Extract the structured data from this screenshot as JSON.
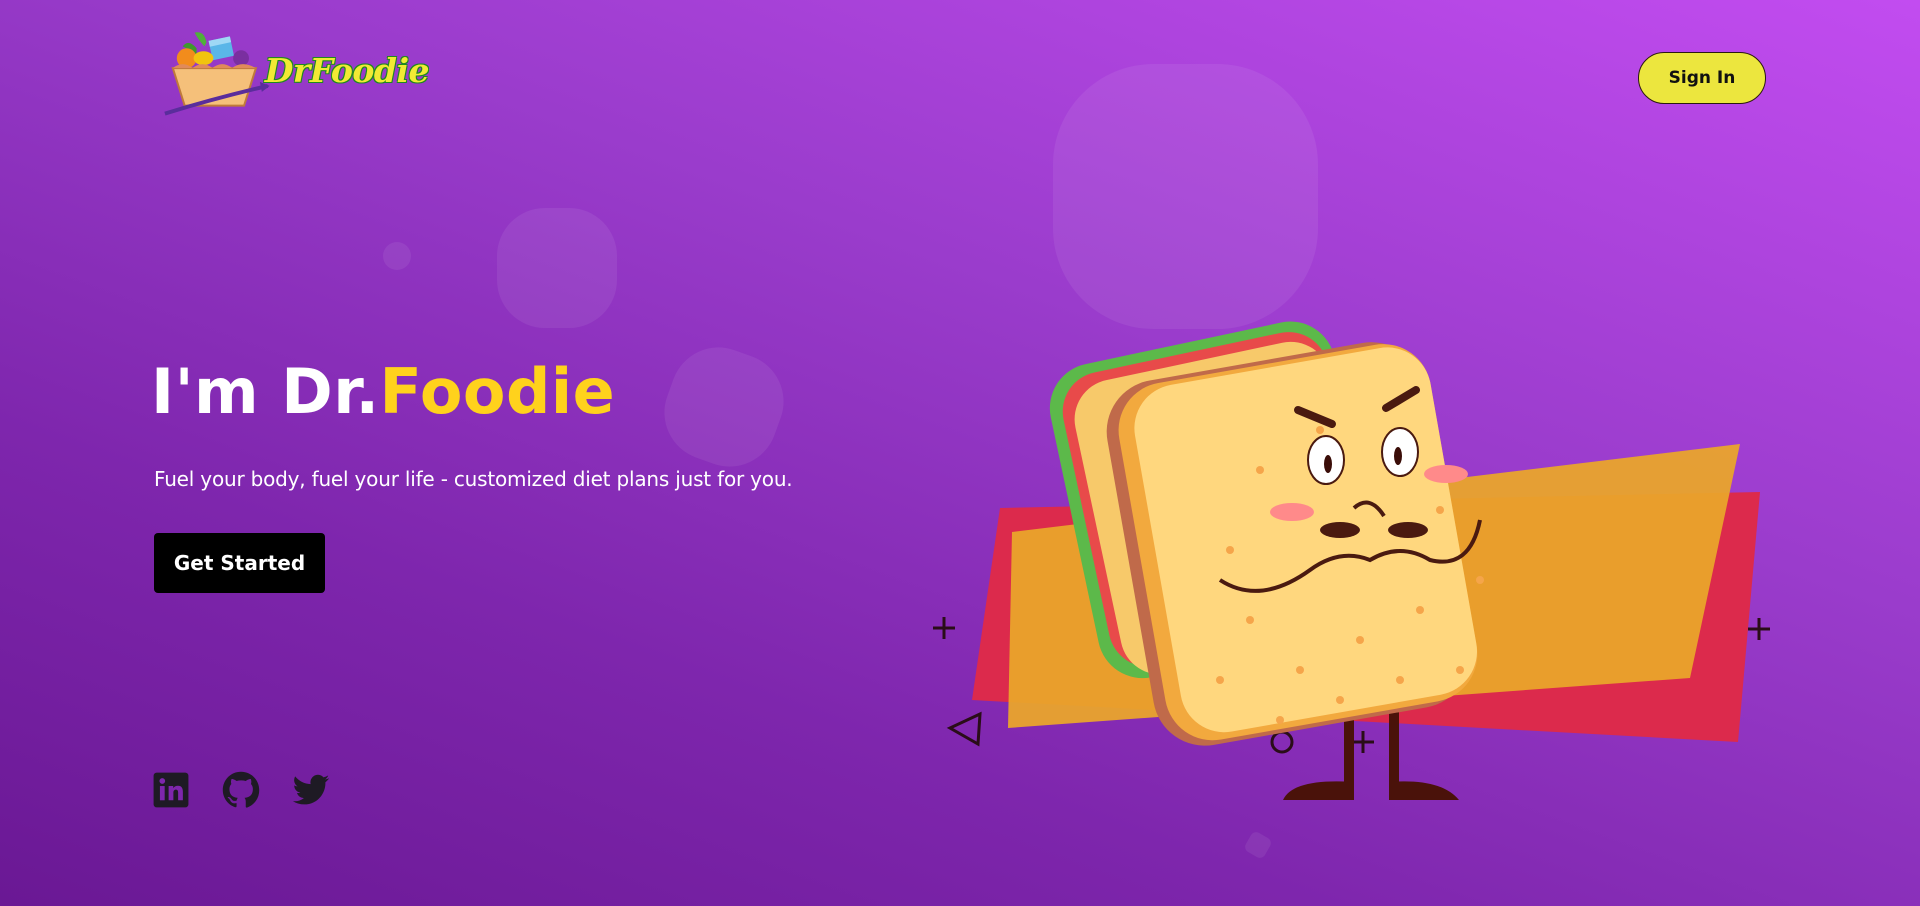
{
  "brand": {
    "name": "DrFoodie",
    "logo_icon": "food-basket-logo"
  },
  "header": {
    "signin_label": "Sign In"
  },
  "hero": {
    "title_prefix": "I'm Dr.",
    "title_accent": "Foodie",
    "subtitle": "Fuel your body, fuel your life - customized diet plans just for you.",
    "cta_label": "Get Started"
  },
  "socials": [
    {
      "icon": "linkedin-icon"
    },
    {
      "icon": "github-icon"
    },
    {
      "icon": "twitter-icon"
    }
  ],
  "colors": {
    "gradient_top": "#c24cf0",
    "gradient_bottom": "#6a1894",
    "accent_yellow": "#ffd21c",
    "signin_bg": "#ece63e",
    "cta_bg": "#000000",
    "panel_red": "#dc2a4c",
    "panel_orange": "#eaa62a"
  },
  "illustration": {
    "icon": "grumpy-sandwich-illustration"
  }
}
